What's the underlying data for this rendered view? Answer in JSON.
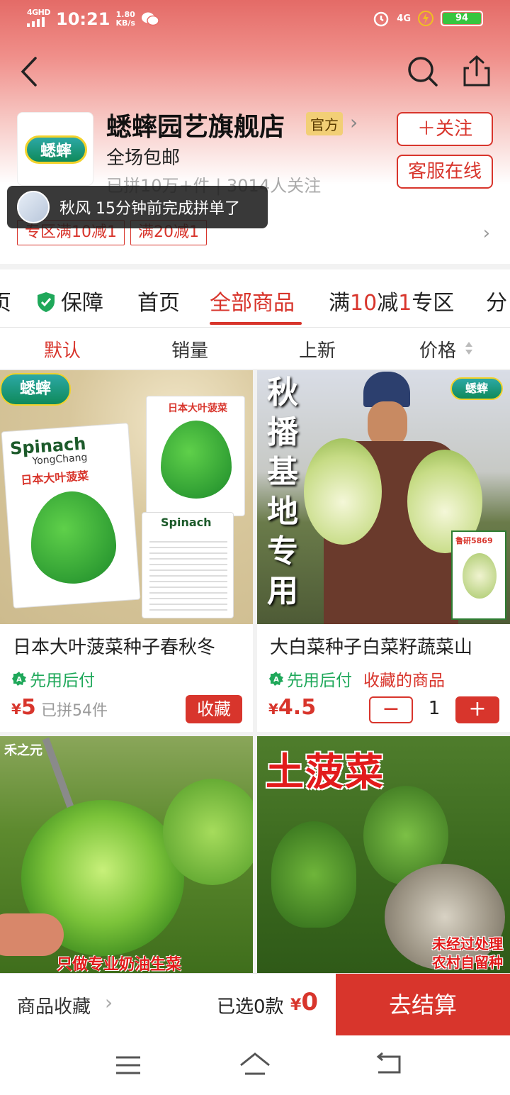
{
  "status": {
    "network": "4GHD",
    "time": "10:21",
    "speed_value": "1.80",
    "speed_unit": "KB/s",
    "network_right": "4G",
    "battery": "94"
  },
  "store": {
    "logo_text": "蟋蟀",
    "name": "蟋蟀园艺旗舰店",
    "official": "官方",
    "shipping": "全场包邮",
    "stats": "已拼10万+件 | 3014人关注",
    "follow": "＋关注",
    "service": "客服在线",
    "coupons": [
      "专区满10减1",
      "满20减1"
    ]
  },
  "toast": {
    "text": "秋风 15分钟前完成拼单了"
  },
  "tabs": {
    "partial_left": "页",
    "guarantee": "保障",
    "home": "首页",
    "all": "全部商品",
    "promo_prefix": "满",
    "promo_n1": "10",
    "promo_mid": "减",
    "promo_n2": "1",
    "promo_suffix": "专区",
    "partial_right": "分"
  },
  "sort": {
    "default": "默认",
    "sales": "销量",
    "new": "上新",
    "price": "价格"
  },
  "products": [
    {
      "title": "日本大叶菠菜种子春秋冬",
      "pay_tag": "先用后付",
      "yen": "¥",
      "price": "5",
      "sold": "已拼54件",
      "action": "收藏",
      "img": {
        "brand": "蟋蟀",
        "packet_en": "Spinach",
        "packet_sub": "YongChang",
        "packet_cn": "日本大叶菠菜"
      }
    },
    {
      "title": "大白菜种子白菜籽蔬菜山",
      "pay_tag": "先用后付",
      "fav_tag": "收藏的商品",
      "yen": "¥",
      "price": "4.5",
      "minus": "−",
      "qty": "1",
      "plus": "+",
      "img": {
        "vertical": [
          "秋",
          "播",
          "基",
          "地",
          "专",
          "用"
        ],
        "brand": "蟋蟀",
        "packet": "鲁研5869"
      }
    },
    {
      "img": {
        "brand": "禾之元",
        "note": "只做专业奶油生菜"
      }
    },
    {
      "img": {
        "banner": "土菠菜",
        "note1": "未经过处理",
        "note2": "农村自留种"
      }
    }
  ],
  "bottom": {
    "favorites": "商品收藏",
    "selected": "已选0款",
    "yen": "¥",
    "total": "0",
    "checkout": "去结算"
  }
}
